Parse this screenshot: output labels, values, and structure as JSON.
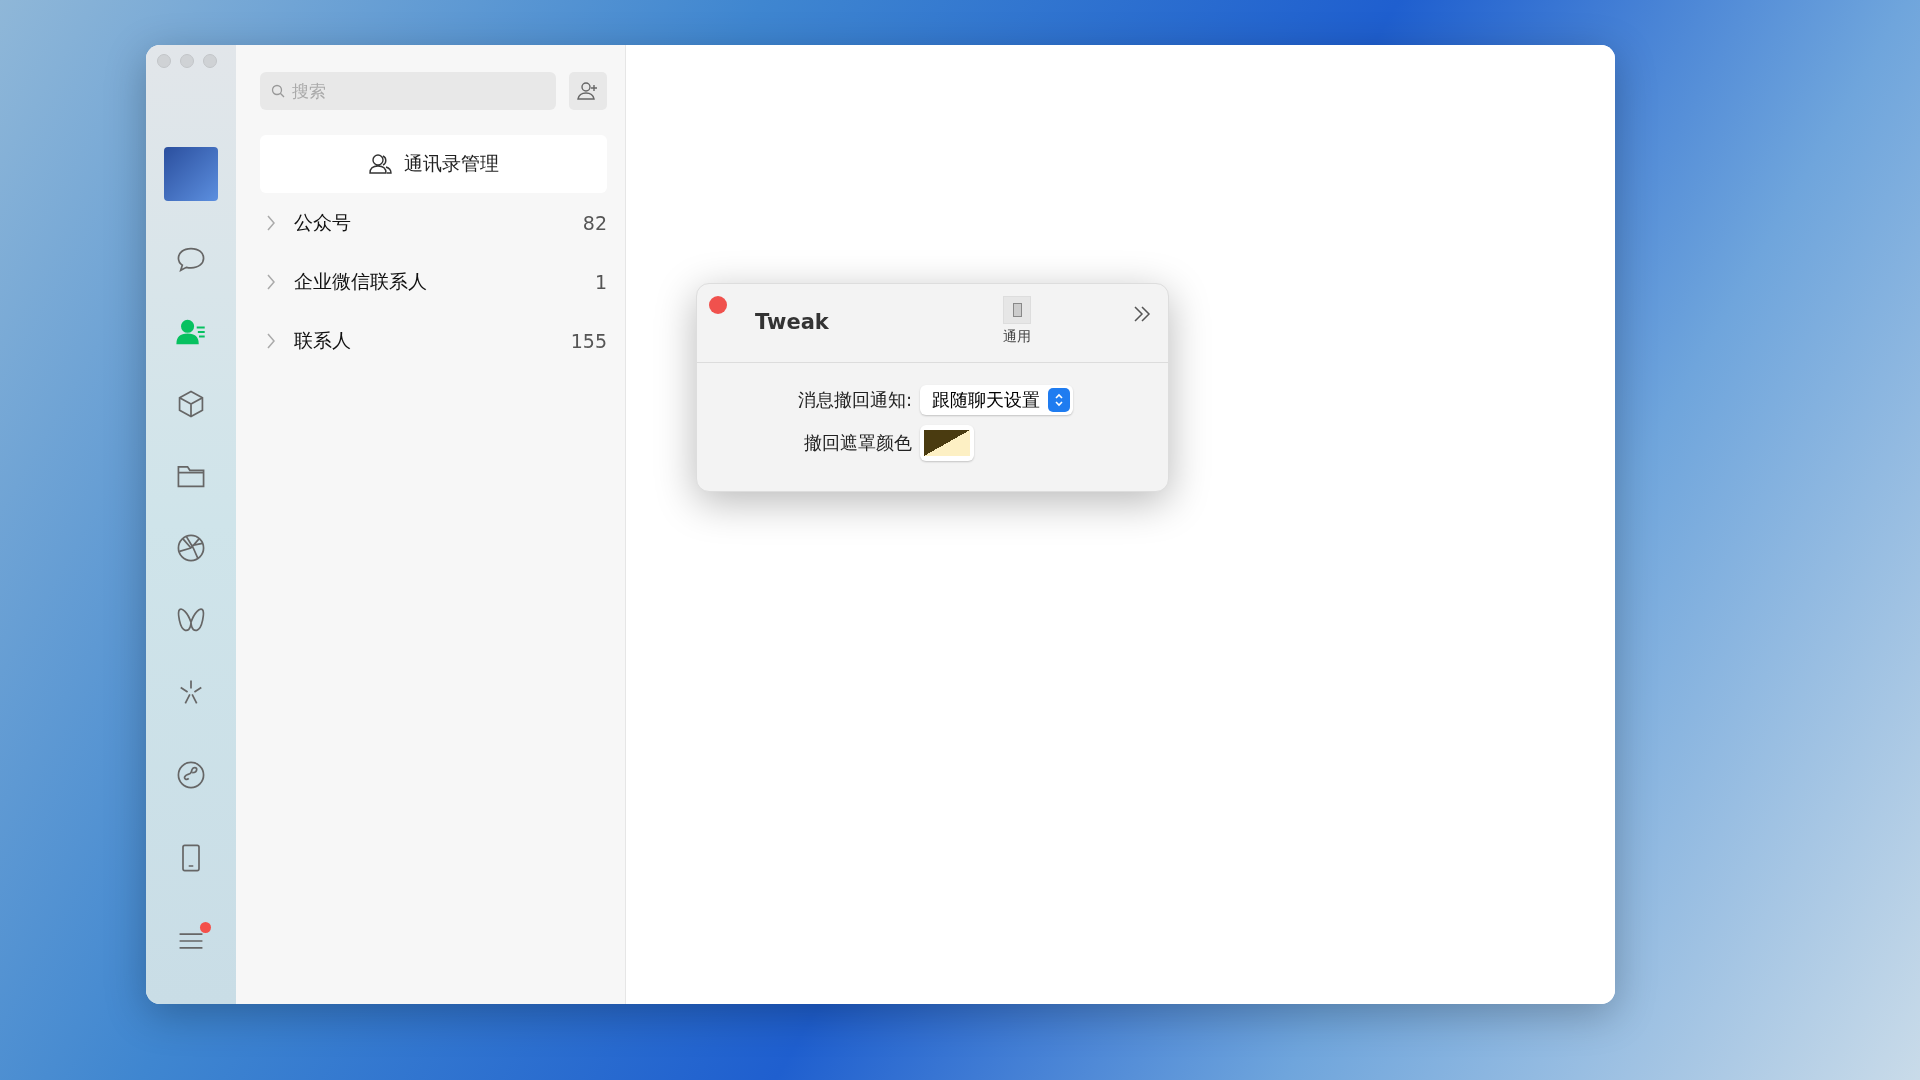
{
  "sidebar": {
    "items": [
      {
        "kind": "avatar",
        "selected": false
      },
      {
        "kind": "chat",
        "selected": false
      },
      {
        "kind": "contacts",
        "selected": true
      },
      {
        "kind": "cube",
        "selected": false
      },
      {
        "kind": "folder",
        "selected": false
      },
      {
        "kind": "aperture",
        "selected": false
      },
      {
        "kind": "butterfly",
        "selected": false
      },
      {
        "kind": "sparkle",
        "selected": false
      },
      {
        "kind": "link",
        "selected": false
      },
      {
        "kind": "phone",
        "selected": false
      },
      {
        "kind": "menu",
        "selected": false,
        "badge": true
      }
    ]
  },
  "search": {
    "placeholder": "搜索"
  },
  "manage_button": {
    "label": "通讯录管理"
  },
  "groups": [
    {
      "label": "公众号",
      "count": "82",
      "expanded": false
    },
    {
      "label": "企业微信联系人",
      "count": "1",
      "expanded": false
    },
    {
      "label": "联系人",
      "count": "155",
      "expanded": false
    }
  ],
  "tweak_dialog": {
    "title": "Tweak",
    "tabs": [
      {
        "label": "通用",
        "selected": true
      }
    ],
    "settings": [
      {
        "kind": "popup",
        "label": "消息撤回通知:",
        "value": "跟随聊天设置"
      },
      {
        "kind": "color",
        "label": "撤回遮罩颜色",
        "color": "#4a3b10"
      }
    ]
  }
}
